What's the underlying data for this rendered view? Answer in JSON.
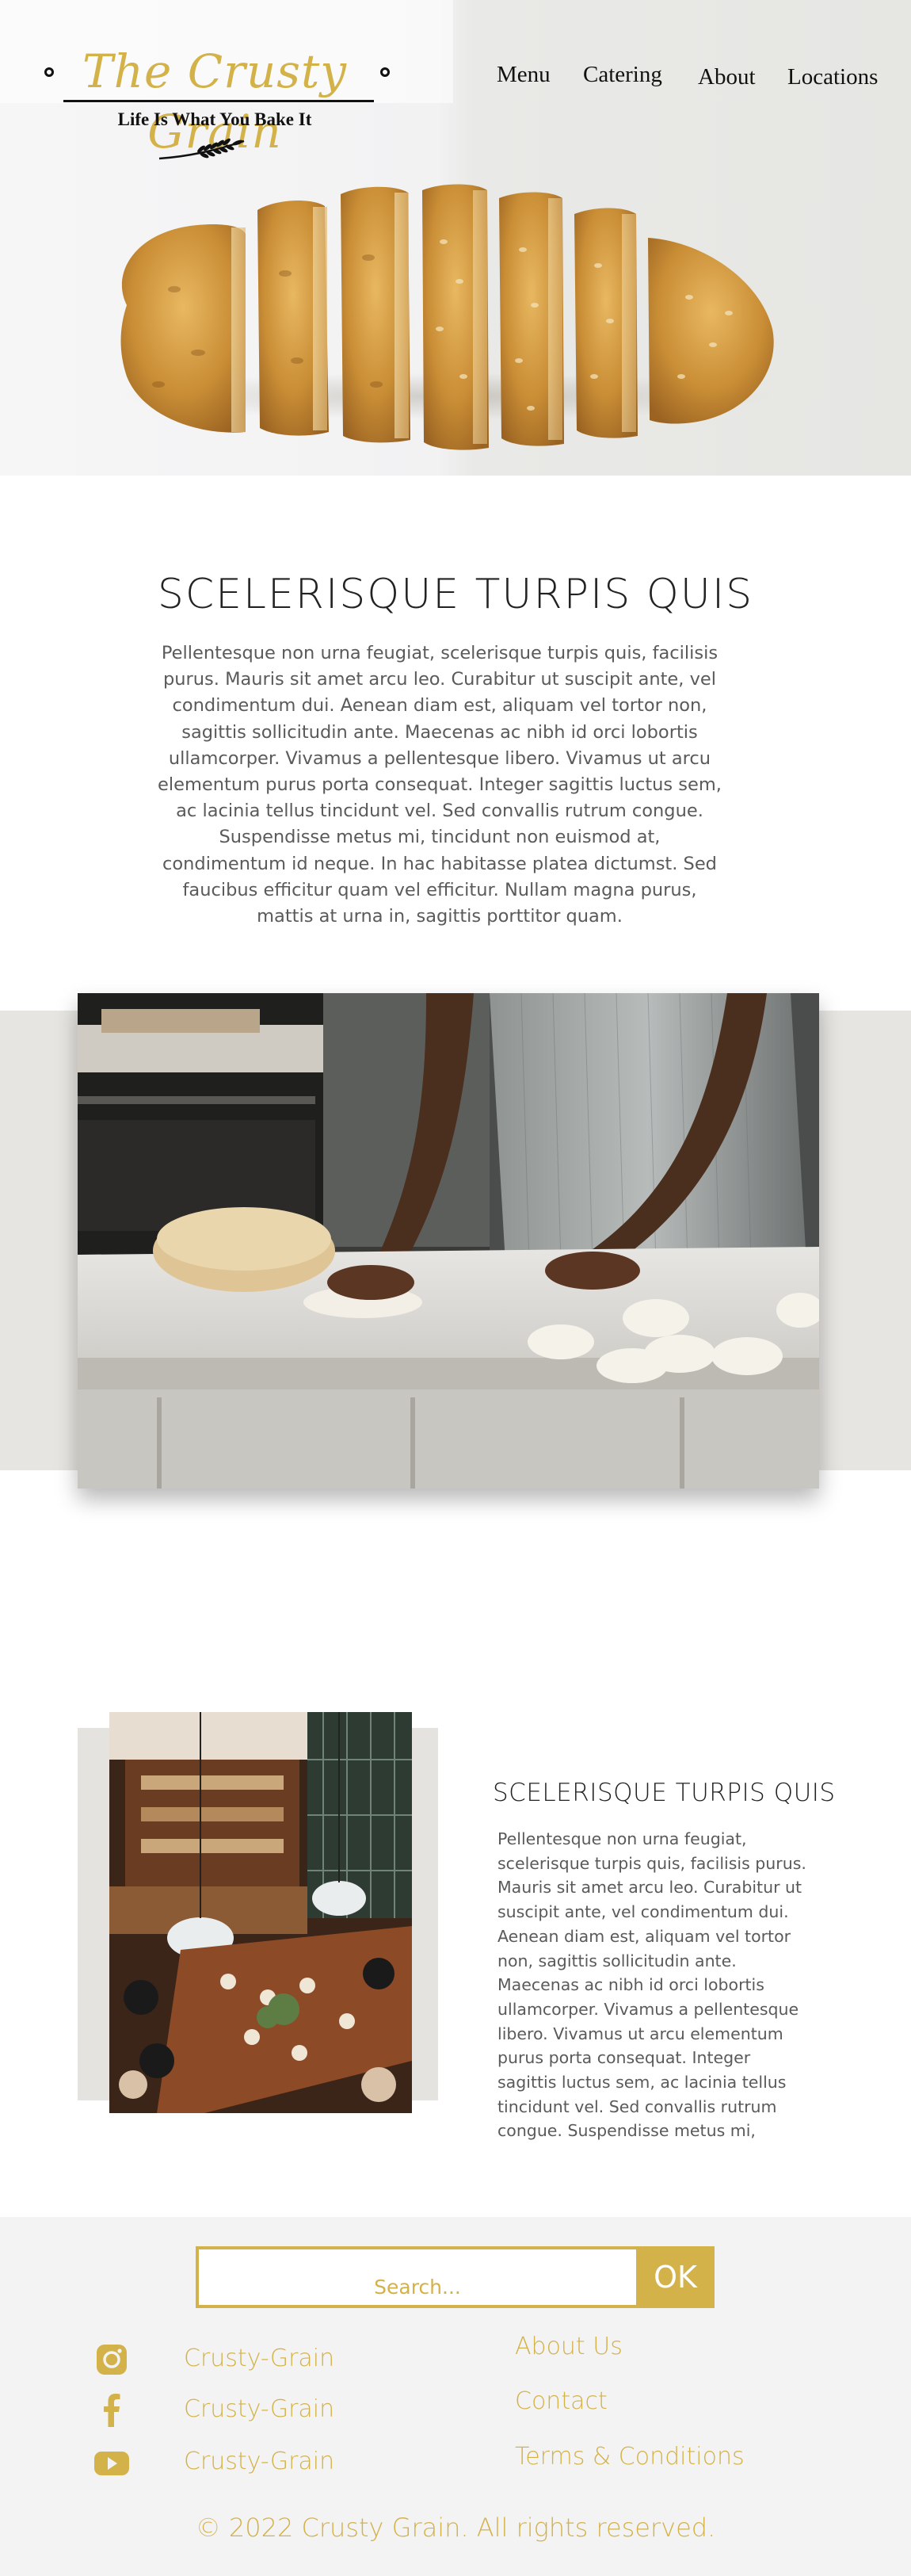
{
  "brand": {
    "name": "The Crusty Grain",
    "tagline": "Life Is What You Bake It",
    "accent_color": "#d4b24a"
  },
  "nav": {
    "items": [
      {
        "label": "Menu"
      },
      {
        "label": "Catering"
      },
      {
        "label": "About"
      },
      {
        "label": "Locations"
      }
    ]
  },
  "intro": {
    "title": "SCELERISQUE TURPIS QUIS",
    "body": "Pellentesque non urna feugiat, scelerisque turpis quis, facilisis purus. Mauris sit amet arcu leo. Curabitur ut suscipit ante, vel condimentum dui. Aenean diam est, aliquam vel tortor non, sagittis sollicitudin ante. Maecenas ac nibh id orci lobortis ullamcorper. Vivamus a pellentesque libero. Vivamus ut arcu elementum purus porta consequat. Integer sagittis luctus sem, ac lacinia tellus tincidunt vel. Sed convallis rutrum congue. Suspendisse metus mi, tincidunt non euismod at, condimentum id neque. In hac habitasse platea dictumst. Sed faucibus efficitur quam vel efficitur. Nullam magna purus, mattis at urna in, sagittis porttitor quam."
  },
  "feature": {
    "title": "SCELERISQUE TURPIS QUIS",
    "body": "Pellentesque non urna feugiat, scelerisque turpis quis, facilisis purus. Mauris sit amet arcu leo. Curabitur ut suscipit ante, vel condimentum dui. Aenean diam est, aliquam vel tortor non, sagittis sollicitudin ante. Maecenas ac nibh id orci lobortis ullamcorper. Vivamus a pellentesque libero. Vivamus ut arcu elementum purus porta consequat. Integer sagittis luctus sem, ac lacinia tellus tincidunt vel. Sed convallis rutrum congue. Suspendisse metus mi, tincidunt non"
  },
  "footer": {
    "search_placeholder": "Search...",
    "ok_label": "OK",
    "social": [
      {
        "icon": "instagram-icon",
        "label": "Crusty-Grain"
      },
      {
        "icon": "facebook-icon",
        "label": "Crusty-Grain"
      },
      {
        "icon": "youtube-icon",
        "label": "Crusty-Grain"
      }
    ],
    "links": [
      {
        "label": "About Us"
      },
      {
        "label": "Contact"
      },
      {
        "label": "Terms & Conditions"
      }
    ],
    "copyright": "© 2022 Crusty Grain. All rights reserved."
  }
}
